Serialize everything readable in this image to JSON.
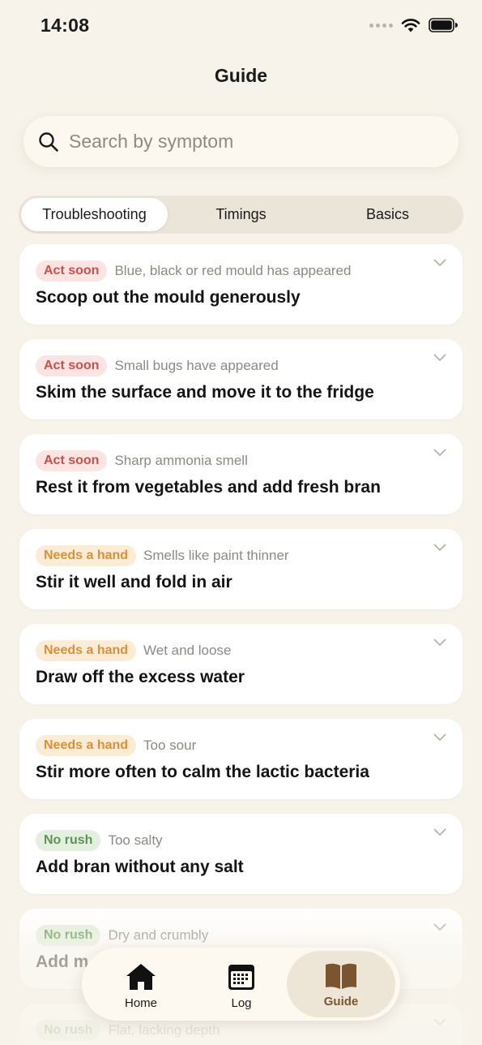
{
  "status_bar": {
    "time": "14:08"
  },
  "header": {
    "title": "Guide"
  },
  "search": {
    "placeholder": "Search by symptom",
    "value": ""
  },
  "segments": [
    {
      "label": "Troubleshooting",
      "selected": true
    },
    {
      "label": "Timings",
      "selected": false
    },
    {
      "label": "Basics",
      "selected": false
    }
  ],
  "items": [
    {
      "badge": "Act soon",
      "severity": "act",
      "symptom": "Blue, black or red mould has appeared",
      "action": "Scoop out the mould generously"
    },
    {
      "badge": "Act soon",
      "severity": "act",
      "symptom": "Small bugs have appeared",
      "action": "Skim the surface and move it to the fridge"
    },
    {
      "badge": "Act soon",
      "severity": "act",
      "symptom": "Sharp ammonia smell",
      "action": "Rest it from vegetables and add fresh bran"
    },
    {
      "badge": "Needs a hand",
      "severity": "needs",
      "symptom": "Smells like paint thinner",
      "action": "Stir it well and fold in air"
    },
    {
      "badge": "Needs a hand",
      "severity": "needs",
      "symptom": "Wet and loose",
      "action": "Draw off the excess water"
    },
    {
      "badge": "Needs a hand",
      "severity": "needs",
      "symptom": "Too sour",
      "action": "Stir more often to calm the lactic bacteria"
    },
    {
      "badge": "No rush",
      "severity": "norush",
      "symptom": "Too salty",
      "action": "Add bran without any salt"
    },
    {
      "badge": "No rush",
      "severity": "norush",
      "symptom": "Dry and crumbly",
      "action": "Add m"
    },
    {
      "badge": "No rush",
      "severity": "norush",
      "symptom": "Flat, lacking depth",
      "action": ""
    }
  ],
  "tabbar": {
    "home_label": "Home",
    "log_label": "Log",
    "guide_label": "Guide",
    "active": "guide"
  },
  "colors": {
    "background": "#f7f3ea",
    "act_soon": "#c8514b",
    "needs_a_hand": "#d7913a",
    "no_rush": "#5f9356",
    "accent_brown": "#7a5530"
  }
}
